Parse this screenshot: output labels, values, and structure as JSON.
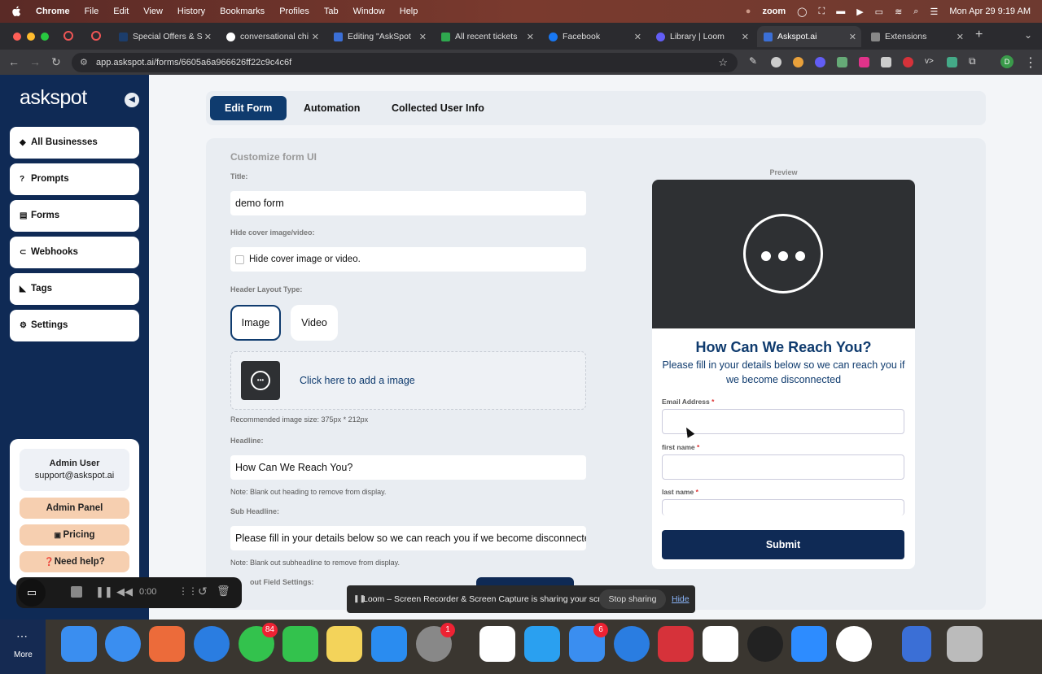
{
  "menubar": {
    "app": "Chrome",
    "items": [
      "File",
      "Edit",
      "View",
      "History",
      "Bookmarks",
      "Profiles",
      "Tab",
      "Window",
      "Help"
    ],
    "right_zoom": "zoom",
    "datetime": "Mon Apr 29  9:19 AM"
  },
  "tabs": [
    {
      "label": "Special Offers & S",
      "color": "#1c3d6b"
    },
    {
      "label": "conversational chi",
      "color": "#ffffff"
    },
    {
      "label": "Editing \"AskSpot",
      "color": "#3b6fd6"
    },
    {
      "label": "All recent tickets",
      "color": "#2fa84f"
    },
    {
      "label": "Facebook",
      "color": "#1877f2"
    },
    {
      "label": "Library | Loom",
      "color": "#625df5"
    },
    {
      "label": "Askspot.ai",
      "color": "#3b6fd6"
    },
    {
      "label": "Extensions",
      "color": "#888888"
    }
  ],
  "address": {
    "url": "app.askspot.ai/forms/6605a6a966626ff22c9c4c6f"
  },
  "sidebar": {
    "logo": "askspot",
    "collapse_glyph": "◀",
    "items": [
      {
        "label": "All Businesses",
        "icon": "◆"
      },
      {
        "label": "Prompts",
        "icon": "?"
      },
      {
        "label": "Forms",
        "icon": "▤"
      },
      {
        "label": "Webhooks",
        "icon": "⊂"
      },
      {
        "label": "Tags",
        "icon": "◣"
      },
      {
        "label": "Settings",
        "icon": "⚙"
      }
    ],
    "user_name": "Admin User",
    "user_email": "support@askspot.ai",
    "admin_panel": "Admin Panel",
    "pricing": "Pricing",
    "need_help": "Need help?"
  },
  "topnav": {
    "edit_form": "Edit Form",
    "automation": "Automation",
    "collected": "Collected User Info"
  },
  "form": {
    "section_title": "Customize form UI",
    "title_label": "Title:",
    "title_value": "demo form",
    "hide_label": "Hide cover image/video:",
    "hide_checkbox_label": "Hide cover image or video.",
    "layout_label": "Header Layout Type:",
    "layout_image": "Image",
    "layout_video": "Video",
    "add_image": "Click here to add a image",
    "recommended": "Recommended image size: 375px * 212px",
    "headline_label": "Headline:",
    "headline_value": "How Can We Reach You?",
    "headline_note": "Note: Blank out heading to remove from display.",
    "sub_label": "Sub Headline:",
    "sub_value": "Please fill in your details below so we can reach you if we become disconnected",
    "sub_note": "Note: Blank out subheadline to remove from display.",
    "input_settings_label": "out Field Settings:"
  },
  "preview": {
    "label": "Preview",
    "title": "How Can We Reach You?",
    "subtitle": "Please fill in your details below so we can reach you if we become disconnected",
    "fields": [
      {
        "label": "Email Address"
      },
      {
        "label": "first name"
      },
      {
        "label": "last name"
      }
    ],
    "submit": "Submit"
  },
  "loom": {
    "time": "0:00",
    "banner": "Loom – Screen Recorder & Screen Capture is sharing your screen.",
    "stop": "Stop sharing",
    "hide": "Hide"
  },
  "dock": {
    "more_label": "More",
    "apps": [
      {
        "name": "finder",
        "color": "#3a8ef0"
      },
      {
        "name": "arc",
        "color": "#3a8ef0"
      },
      {
        "name": "launchpad",
        "color": "#ec6b3a"
      },
      {
        "name": "safari",
        "color": "#2a7de1"
      },
      {
        "name": "messages",
        "color": "#33c24d",
        "badge": "84"
      },
      {
        "name": "facetime",
        "color": "#33c24d"
      },
      {
        "name": "notes",
        "color": "#f3d35a"
      },
      {
        "name": "app-store",
        "color": "#2a8cf0"
      },
      {
        "name": "system-settings",
        "color": "#888888",
        "badge": "1"
      },
      {
        "name": "slack",
        "color": "#ffffff"
      },
      {
        "name": "calendar-app",
        "color": "#2aa0f0"
      },
      {
        "name": "mail",
        "color": "#3a8ef0",
        "badge": "6"
      },
      {
        "name": "testflight",
        "color": "#2a7de1"
      },
      {
        "name": "express-vpn",
        "color": "#d6323a"
      },
      {
        "name": "setapp",
        "color": "#ffffff"
      },
      {
        "name": "loom",
        "color": "#222222"
      },
      {
        "name": "zoom",
        "color": "#2d8cff"
      },
      {
        "name": "chrome",
        "color": "#ffffff"
      },
      {
        "name": "preview-doc",
        "color": "#3b6fd6"
      },
      {
        "name": "trash",
        "color": "#bbbbbb"
      }
    ]
  }
}
